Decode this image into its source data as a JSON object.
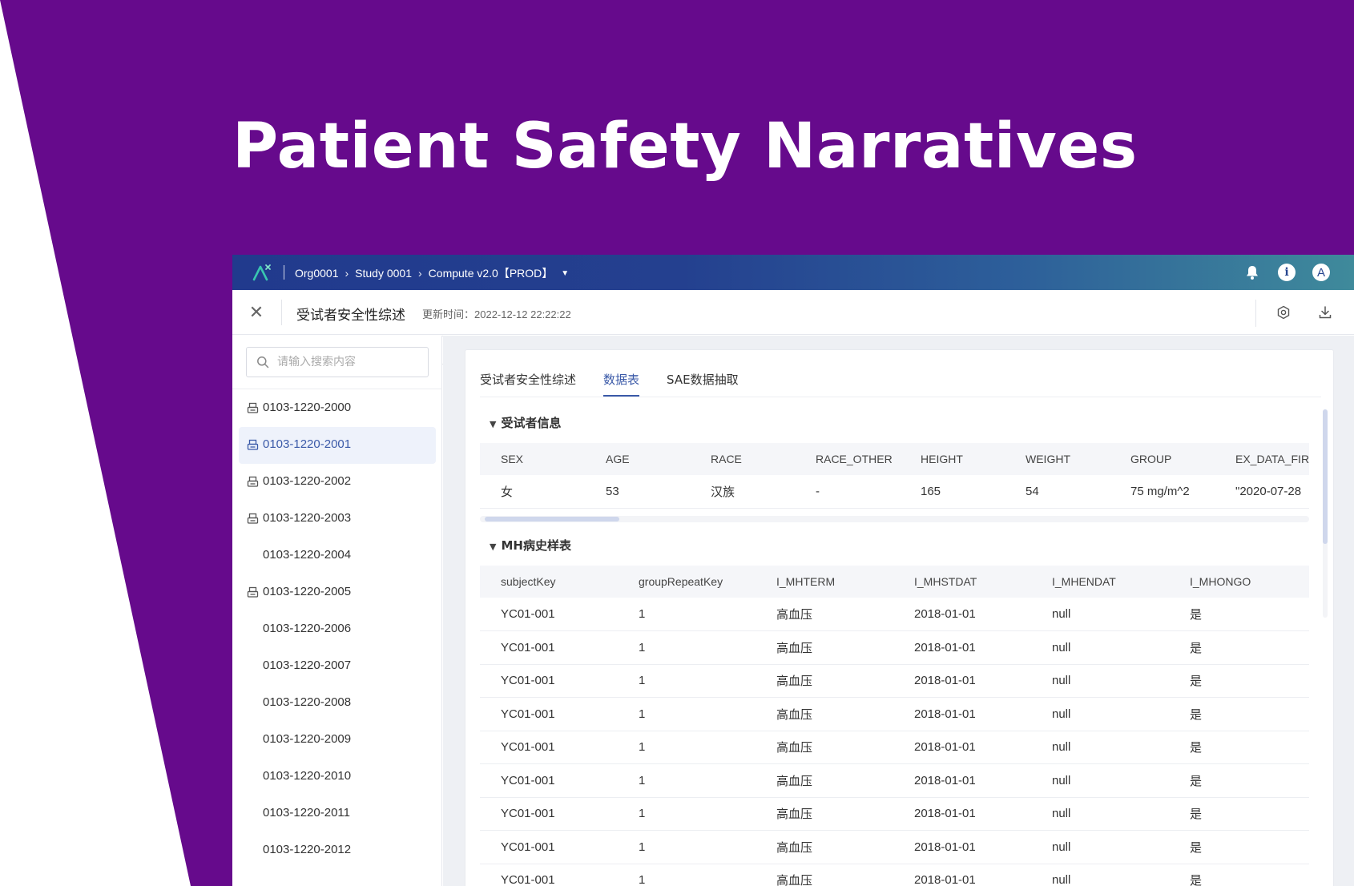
{
  "hero": {
    "title": "Patient Safety Narratives"
  },
  "topbar": {
    "breadcrumb": [
      {
        "label": "Org0001"
      },
      {
        "label": "Study 0001"
      },
      {
        "label": "Compute v2.0【PROD】"
      }
    ],
    "avatar_letter": "A",
    "info_letter": "i"
  },
  "subheader": {
    "title": "受试者安全性综述",
    "update_time": "更新时间：2022-12-12 22:22:22"
  },
  "sidebar": {
    "search_placeholder": "请输入搜索内容",
    "items": [
      {
        "label": "0103-1220-2000",
        "icon": "printer-icon",
        "active": false
      },
      {
        "label": "0103-1220-2001",
        "icon": "printer-icon",
        "active": true
      },
      {
        "label": "0103-1220-2002",
        "icon": "printer-icon",
        "active": false
      },
      {
        "label": "0103-1220-2003",
        "icon": "printer-icon",
        "active": false
      },
      {
        "label": "0103-1220-2004",
        "icon": "",
        "active": false
      },
      {
        "label": "0103-1220-2005",
        "icon": "printer-icon",
        "active": false
      },
      {
        "label": "0103-1220-2006",
        "icon": "",
        "active": false
      },
      {
        "label": "0103-1220-2007",
        "icon": "",
        "active": false
      },
      {
        "label": "0103-1220-2008",
        "icon": "",
        "active": false
      },
      {
        "label": "0103-1220-2009",
        "icon": "",
        "active": false
      },
      {
        "label": "0103-1220-2010",
        "icon": "",
        "active": false
      },
      {
        "label": "0103-1220-2011",
        "icon": "",
        "active": false
      },
      {
        "label": "0103-1220-2012",
        "icon": "",
        "active": false
      }
    ]
  },
  "tabs": [
    {
      "label": "受试者安全性综述",
      "active": false
    },
    {
      "label": "数据表",
      "active": true
    },
    {
      "label": "SAE数据抽取",
      "active": false
    }
  ],
  "subject_info": {
    "title": "受试者信息",
    "columns": [
      "SEX",
      "AGE",
      "RACE",
      "RACE_OTHER",
      "HEIGHT",
      "WEIGHT",
      "GROUP",
      "EX_DATA_FIRST"
    ],
    "rows": [
      [
        "女",
        "53",
        "汉族",
        "-",
        "165",
        "54",
        "75 mg/m^2",
        "\"2020-07-28"
      ]
    ]
  },
  "mh_table": {
    "title": "MH病史样表",
    "columns": [
      "subjectKey",
      "groupRepeatKey",
      "I_MHTERM",
      "I_MHSTDAT",
      "I_MHENDAT",
      "I_MHONGO"
    ],
    "rows": [
      [
        "YC01-001",
        "1",
        "高血压",
        "2018-01-01",
        "null",
        "是"
      ],
      [
        "YC01-001",
        "1",
        "高血压",
        "2018-01-01",
        "null",
        "是"
      ],
      [
        "YC01-001",
        "1",
        "高血压",
        "2018-01-01",
        "null",
        "是"
      ],
      [
        "YC01-001",
        "1",
        "高血压",
        "2018-01-01",
        "null",
        "是"
      ],
      [
        "YC01-001",
        "1",
        "高血压",
        "2018-01-01",
        "null",
        "是"
      ],
      [
        "YC01-001",
        "1",
        "高血压",
        "2018-01-01",
        "null",
        "是"
      ],
      [
        "YC01-001",
        "1",
        "高血压",
        "2018-01-01",
        "null",
        "是"
      ],
      [
        "YC01-001",
        "1",
        "高血压",
        "2018-01-01",
        "null",
        "是"
      ],
      [
        "YC01-001",
        "1",
        "高血压",
        "2018-01-01",
        "null",
        "是"
      ]
    ]
  },
  "colors": {
    "background_purple": "#660a8c",
    "accent_blue": "#3b5aa8"
  }
}
